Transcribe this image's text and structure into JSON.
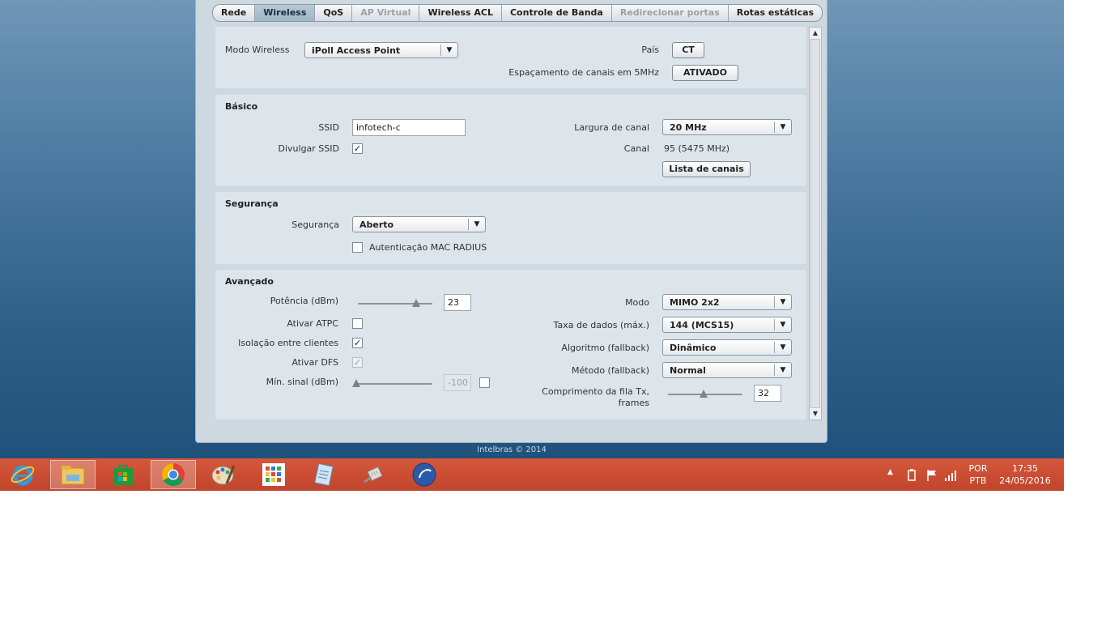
{
  "tabs": [
    {
      "label": "Rede",
      "state": "normal"
    },
    {
      "label": "Wireless",
      "state": "active"
    },
    {
      "label": "QoS",
      "state": "normal"
    },
    {
      "label": "AP Virtual",
      "state": "disabled"
    },
    {
      "label": "Wireless ACL",
      "state": "normal"
    },
    {
      "label": "Controle de Banda",
      "state": "normal"
    },
    {
      "label": "Redirecionar portas",
      "state": "disabled"
    },
    {
      "label": "Rotas estáticas",
      "state": "normal"
    }
  ],
  "top": {
    "mode_label": "Modo Wireless",
    "mode_value": "iPoll Access Point",
    "country_label": "País",
    "country_value": "CT",
    "spacing_label": "Espaçamento de canais em 5MHz",
    "spacing_value": "ATIVADO"
  },
  "basic": {
    "title": "Básico",
    "ssid_label": "SSID",
    "ssid_value": "infotech-c",
    "broadcast_label": "Divulgar SSID",
    "broadcast_checked": true,
    "width_label": "Largura de canal",
    "width_value": "20 MHz",
    "channel_label": "Canal",
    "channel_value": "95 (5475 MHz)",
    "channel_list_button": "Lista de canais"
  },
  "security": {
    "title": "Segurança",
    "label": "Segurança",
    "value": "Aberto",
    "mac_radius_label": "Autenticação MAC RADIUS",
    "mac_radius_checked": false
  },
  "advanced": {
    "title": "Avançado",
    "power_label": "Potência (dBm)",
    "power_value": "23",
    "power_level": 0.78,
    "atpc_label": "Ativar ATPC",
    "atpc_checked": false,
    "isolation_label": "Isolação entre clientes",
    "isolation_checked": true,
    "dfs_label": "Ativar DFS",
    "dfs_checked": true,
    "min_signal_label": "Mín. sinal (dBm)",
    "min_signal_value": "-100",
    "min_signal_level": 0.0,
    "min_signal_checked": false,
    "mode_label": "Modo",
    "mode_value": "MIMO 2x2",
    "rate_label": "Taxa de dados (máx.)",
    "rate_value": "144 (MCS15)",
    "algo_label": "Algoritmo (fallback)",
    "algo_value": "Dinâmico",
    "method_label": "Método (fallback)",
    "method_value": "Normal",
    "queue_label_line1": "Comprimento da fila Tx,",
    "queue_label_line2": "frames",
    "queue_value": "32",
    "queue_level": 0.48
  },
  "footer": "Intelbras © 2014",
  "tray": {
    "lang_line1": "POR",
    "lang_line2": "PTB",
    "time": "17:35",
    "date": "24/05/2016"
  },
  "icons": {
    "ie": "internet-explorer-icon",
    "explorer": "file-explorer-icon",
    "store": "store-icon",
    "chrome": "chrome-icon",
    "paint": "paint-palette-icon",
    "apps": "apps-grid-icon",
    "notepad": "notepad-icon",
    "network": "network-cable-icon",
    "winbox": "winbox-icon"
  }
}
